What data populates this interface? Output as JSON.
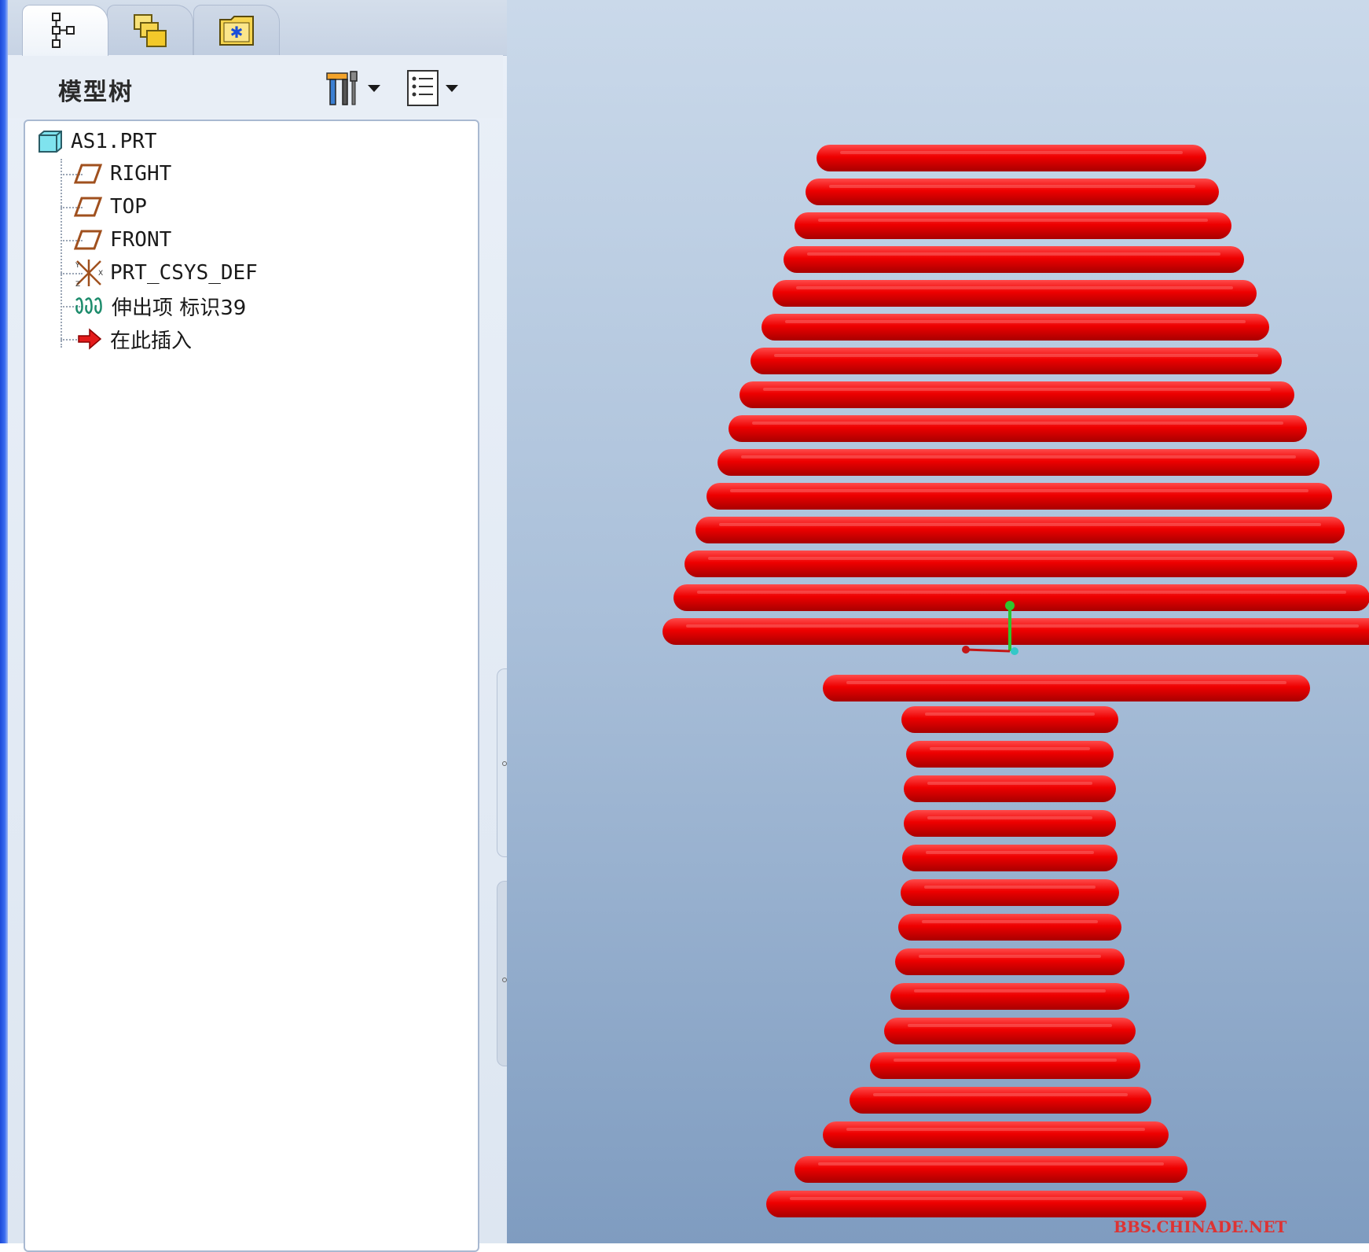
{
  "app": {
    "panel_title": "模型树",
    "tabs": [
      {
        "icon": "model-tree-icon"
      },
      {
        "icon": "folder-browser-icon"
      },
      {
        "icon": "favorites-icon"
      }
    ],
    "toolbar": {
      "settings_icon": "tools-icon",
      "show_icon": "list-icon"
    }
  },
  "tree": {
    "root": {
      "label": "AS1.PRT",
      "icon": "part-icon"
    },
    "items": [
      {
        "label": "RIGHT",
        "icon": "datum-plane-icon"
      },
      {
        "label": "TOP",
        "icon": "datum-plane-icon"
      },
      {
        "label": "FRONT",
        "icon": "datum-plane-icon"
      },
      {
        "label": "PRT_CSYS_DEF",
        "icon": "coordinate-system-icon"
      },
      {
        "label": "伸出项 标识39",
        "icon": "protrusion-icon"
      },
      {
        "label": "在此插入",
        "icon": "insert-here-arrow-icon"
      }
    ]
  },
  "viewport": {
    "model_color": "#ee0000",
    "watermark": "BBS.CHINADE.NET"
  },
  "colors": {
    "accent_blue": "#1b49d8",
    "panel_bg": "#e8eef6",
    "viewport_top": "#cad9ea",
    "viewport_bottom": "#7f9cc0"
  }
}
